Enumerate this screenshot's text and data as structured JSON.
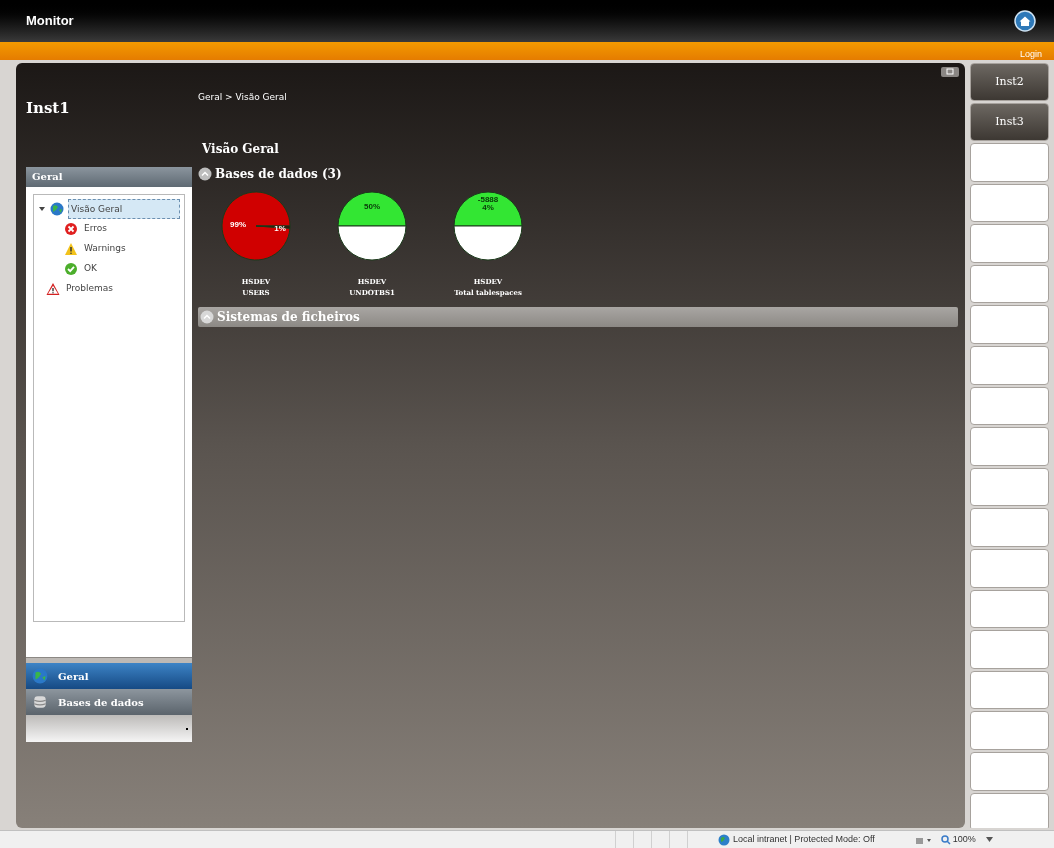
{
  "app": {
    "title": "Monitor",
    "login": "Login"
  },
  "instance": {
    "title": "Inst1"
  },
  "breadcrumb": "Geral > Visão Geral",
  "sidebar": {
    "header": "Geral",
    "tree": [
      {
        "label": "Visão Geral",
        "kind": "globe",
        "selected": true,
        "expanded": true,
        "children": [
          {
            "label": "Erros",
            "kind": "error",
            "selected": false
          },
          {
            "label": "Warnings",
            "kind": "warning",
            "selected": false
          },
          {
            "label": "OK",
            "kind": "ok",
            "selected": false
          }
        ]
      },
      {
        "label": "Problemas",
        "kind": "alert",
        "selected": false
      }
    ],
    "accordion": [
      {
        "label": "Geral",
        "kind": "globe",
        "selected": true
      },
      {
        "label": "Bases de dados",
        "kind": "database",
        "selected": false
      }
    ]
  },
  "content": {
    "title": "Visão Geral",
    "sections": [
      {
        "title": "Bases de dados (3)",
        "expanded": true,
        "charts": [
          {
            "name_lines": [
              "HSDEV",
              "USERS"
            ],
            "chart_data": {
              "type": "pie",
              "values": [
                99,
                1
              ],
              "colors": [
                "#d00000",
                "#3a0000"
              ],
              "value_labels": [
                "99%",
                "1%"
              ]
            }
          },
          {
            "name_lines": [
              "HSDEV",
              "UNDOTBS1"
            ],
            "chart_data": {
              "type": "pie",
              "values": [
                50,
                50
              ],
              "colors": [
                "#33e633",
                "#ffffff"
              ],
              "value_labels": [
                "50%",
                null
              ]
            }
          },
          {
            "name_lines": [
              "HSDEV",
              "Total tablespaces"
            ],
            "chart_data": {
              "type": "pie",
              "values": [
                50,
                50
              ],
              "colors": [
                "#33e633",
                "#ffffff"
              ],
              "annotations": [
                "-5888",
                "4%"
              ]
            }
          }
        ]
      },
      {
        "title": "Sistemas de ficheiros",
        "expanded": false
      }
    ]
  },
  "instance_tabs": [
    {
      "label": "Inst2"
    },
    {
      "label": "Inst3"
    }
  ],
  "status_bar": {
    "zone": "Local intranet | Protected Mode: Off",
    "zoom": "100%"
  }
}
